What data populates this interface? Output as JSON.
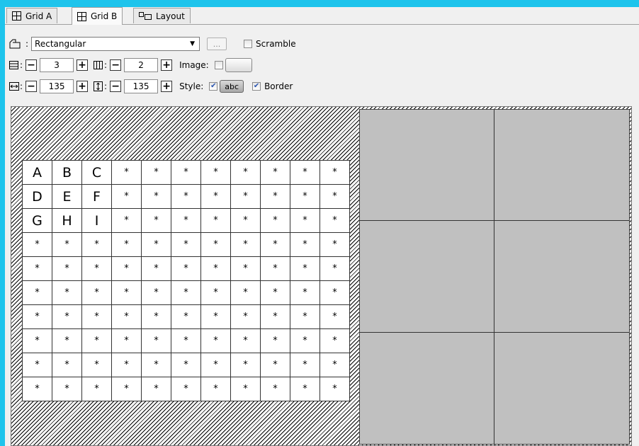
{
  "tabs": [
    {
      "label": "Grid A",
      "icon": "grid-icon",
      "active": false
    },
    {
      "label": "Grid B",
      "icon": "grid-icon",
      "active": true
    },
    {
      "label": "Layout",
      "icon": "layout-icon",
      "active": false
    }
  ],
  "shape_row": {
    "icon": "shape-icon",
    "select_value": "Rectangular",
    "ellipsis_label": "...",
    "scramble": {
      "label": "Scramble",
      "checked": false
    }
  },
  "count_row": {
    "rows_icon": "rows-icon",
    "rows_value": "3",
    "cols_icon": "columns-icon",
    "cols_value": "2",
    "image_label": "Image:",
    "image_checked": false
  },
  "size_row": {
    "width_icon": "width-icon",
    "width_value": "135",
    "height_icon": "height-icon",
    "height_value": "135",
    "style_label": "Style:",
    "style_checked": true,
    "style_button": "abc",
    "border": {
      "label": "Border",
      "checked": true
    }
  },
  "stepper": {
    "minus": "−",
    "plus": "+"
  },
  "letter_grid": {
    "columns": 11,
    "rows": [
      [
        "A",
        "B",
        "C",
        "*",
        "*",
        "*",
        "*",
        "*",
        "*",
        "*",
        "*"
      ],
      [
        "D",
        "E",
        "F",
        "*",
        "*",
        "*",
        "*",
        "*",
        "*",
        "*",
        "*"
      ],
      [
        "G",
        "H",
        "I",
        "*",
        "*",
        "*",
        "*",
        "*",
        "*",
        "*",
        "*"
      ],
      [
        "*",
        "*",
        "*",
        "*",
        "*",
        "*",
        "*",
        "*",
        "*",
        "*",
        "*"
      ],
      [
        "*",
        "*",
        "*",
        "*",
        "*",
        "*",
        "*",
        "*",
        "*",
        "*",
        "*"
      ],
      [
        "*",
        "*",
        "*",
        "*",
        "*",
        "*",
        "*",
        "*",
        "*",
        "*",
        "*"
      ],
      [
        "*",
        "*",
        "*",
        "*",
        "*",
        "*",
        "*",
        "*",
        "*",
        "*",
        "*"
      ],
      [
        "*",
        "*",
        "*",
        "*",
        "*",
        "*",
        "*",
        "*",
        "*",
        "*",
        "*"
      ],
      [
        "*",
        "*",
        "*",
        "*",
        "*",
        "*",
        "*",
        "*",
        "*",
        "*",
        "*"
      ],
      [
        "*",
        "*",
        "*",
        "*",
        "*",
        "*",
        "*",
        "*",
        "*",
        "*",
        "*"
      ]
    ]
  },
  "tile_preview": {
    "rows": 3,
    "cols": 2,
    "fill_color": "#c0c0c0"
  },
  "colors": {
    "frame": "#1ec4ec",
    "panel": "#f0f0f0",
    "checkbox_check": "#2a55b0"
  }
}
